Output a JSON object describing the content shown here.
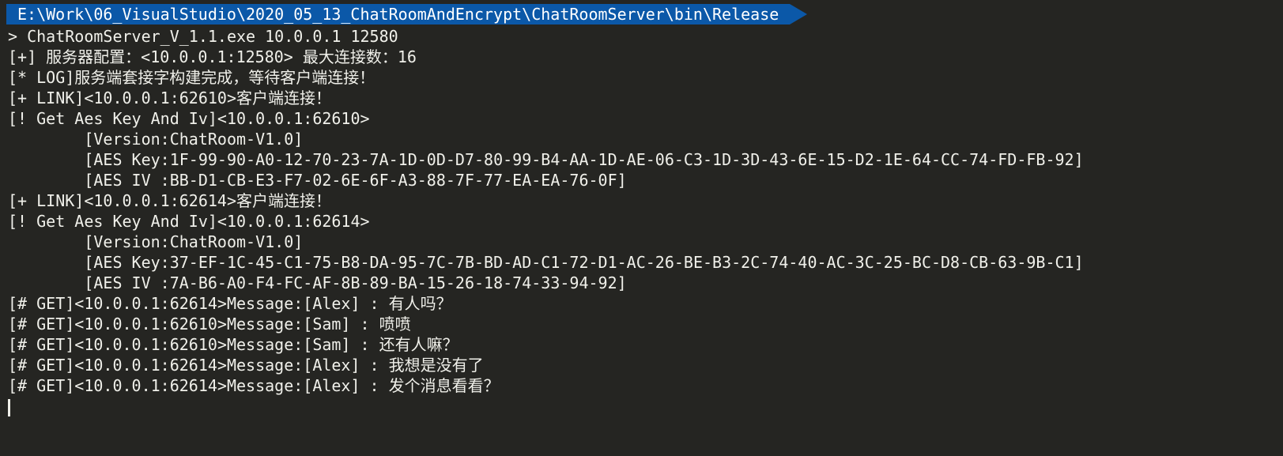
{
  "window": {
    "prompt_path": "E:\\Work\\06_VisualStudio\\2020_05_13_ChatRoomAndEncrypt\\ChatRoomServer\\bin\\Release"
  },
  "terminal": {
    "lines": [
      "> ChatRoomServer_V_1.1.exe 10.0.0.1 12580",
      "[+] 服务器配置：<10.0.0.1:12580> 最大连接数：16",
      "[* LOG]服务端套接字构建完成，等待客户端连接！",
      "[+ LINK]<10.0.0.1:62610>客户端连接！",
      "[! Get Aes Key And Iv]<10.0.0.1:62610>",
      "        [Version:ChatRoom-V1.0]",
      "        [AES Key:1F-99-90-A0-12-70-23-7A-1D-0D-D7-80-99-B4-AA-1D-AE-06-C3-1D-3D-43-6E-15-D2-1E-64-CC-74-FD-FB-92]",
      "        [AES IV :BB-D1-CB-E3-F7-02-6E-6F-A3-88-7F-77-EA-EA-76-0F]",
      "[+ LINK]<10.0.0.1:62614>客户端连接！",
      "[! Get Aes Key And Iv]<10.0.0.1:62614>",
      "        [Version:ChatRoom-V1.0]",
      "        [AES Key:37-EF-1C-45-C1-75-B8-DA-95-7C-7B-BD-AD-C1-72-D1-AC-26-BE-B3-2C-74-40-AC-3C-25-BC-D8-CB-63-9B-C1]",
      "        [AES IV :7A-B6-A0-F4-FC-AF-8B-89-BA-15-26-18-74-33-94-92]",
      "[# GET]<10.0.0.1:62614>Message:[Alex] : 有人吗？",
      "[# GET]<10.0.0.1:62610>Message:[Sam] : 喷喷",
      "[# GET]<10.0.0.1:62610>Message:[Sam] : 还有人嘛？",
      "[# GET]<10.0.0.1:62614>Message:[Alex] : 我想是没有了",
      "[# GET]<10.0.0.1:62614>Message:[Alex] : 发个消息看看？"
    ]
  }
}
